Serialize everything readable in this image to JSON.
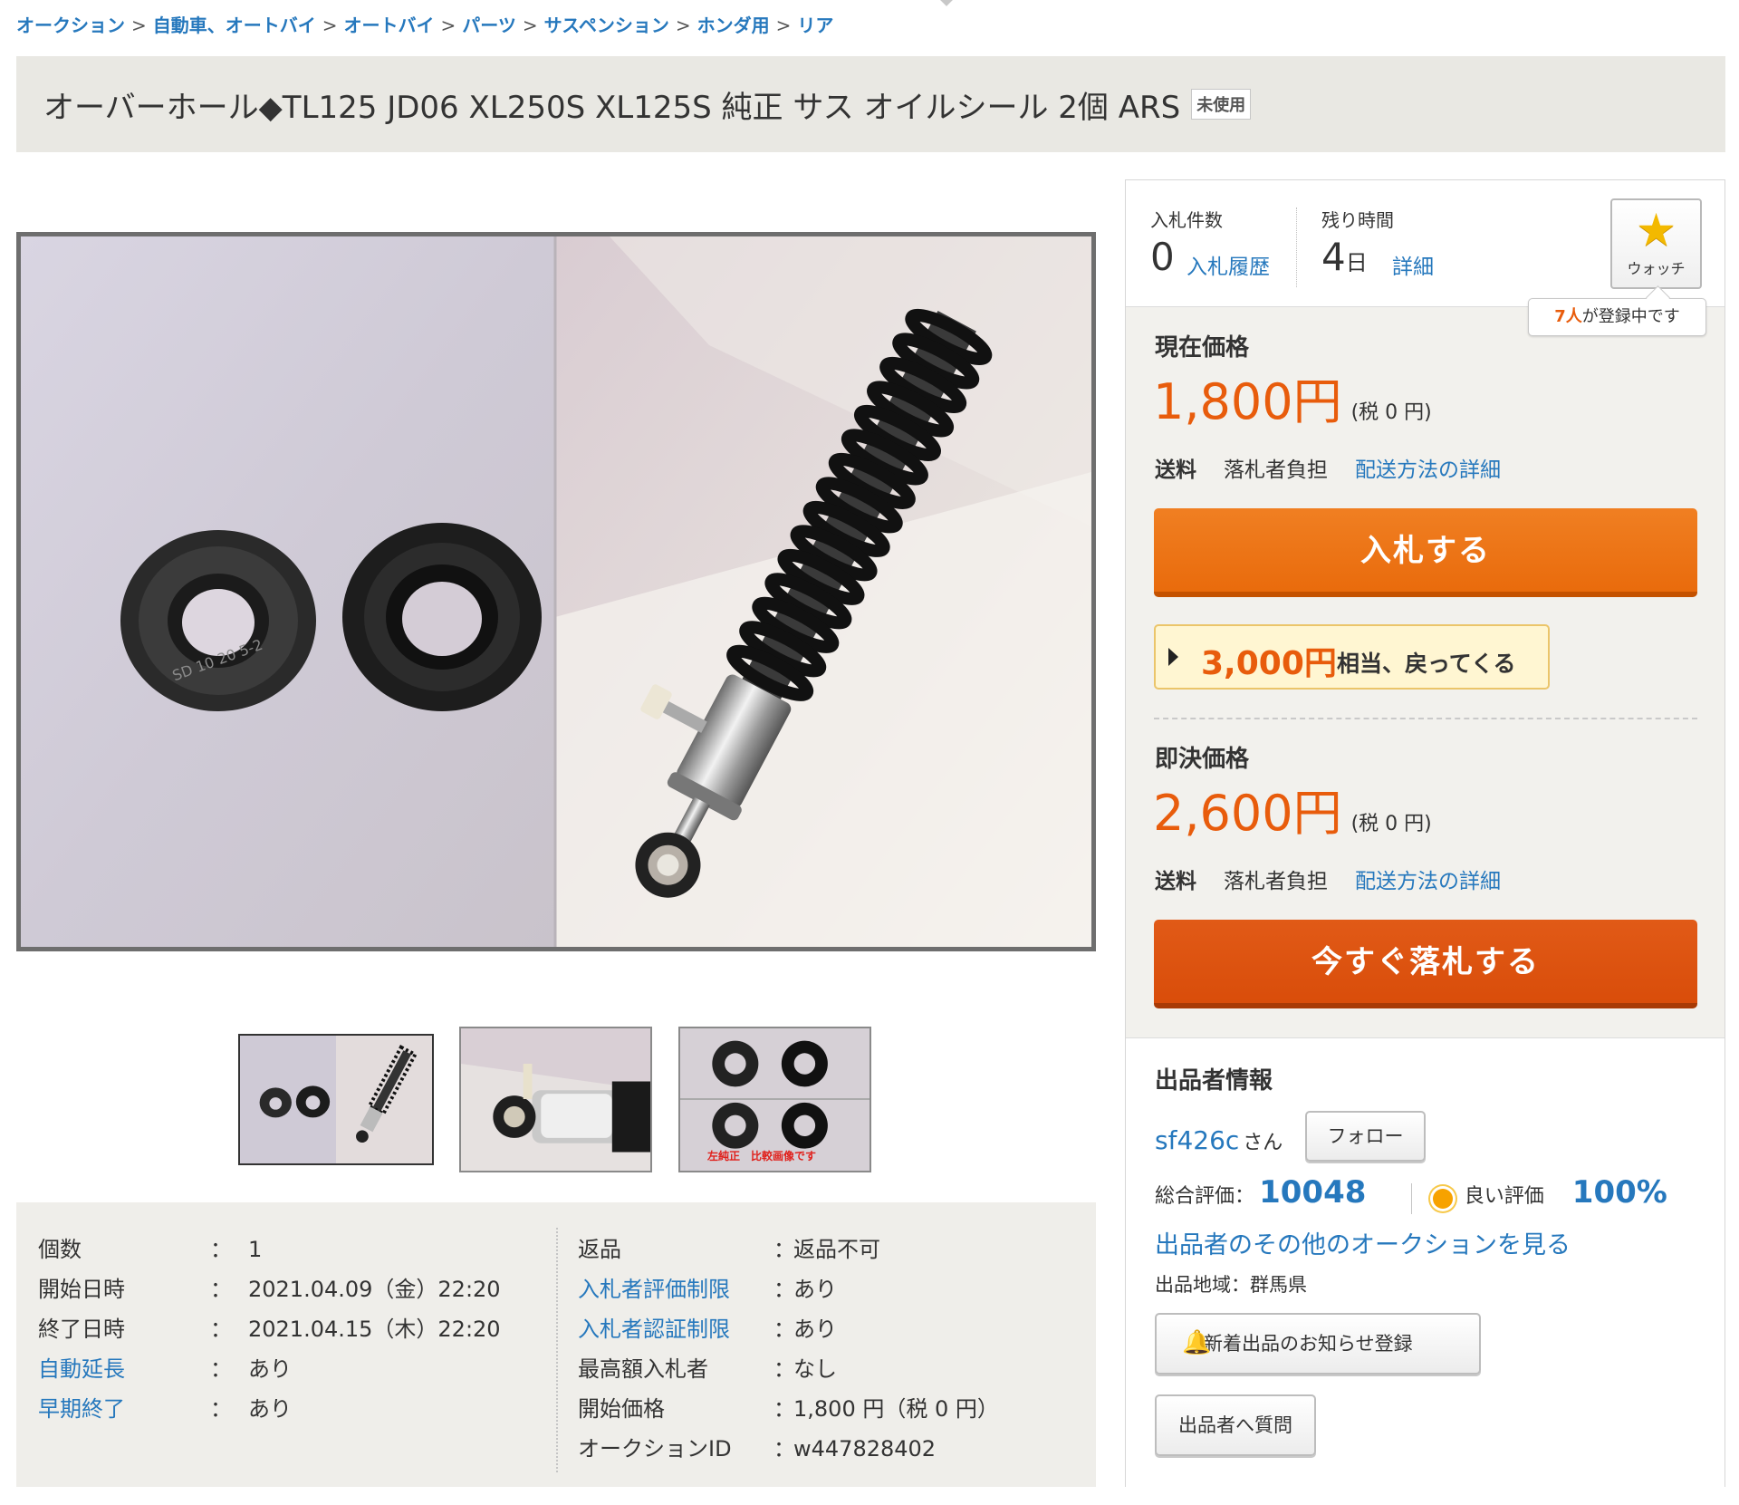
{
  "breadcrumb": [
    "オークション",
    "自動車、オートバイ",
    "オートバイ",
    "パーツ",
    "サスペンション",
    "ホンダ用",
    "リア"
  ],
  "breadcrumb_separator": ">",
  "title": "オーバーホール◆TL125 JD06 XL250S XL125S 純正 サス オイルシール 2個 ARS",
  "condition_badge": "未使用",
  "main_image": {
    "alt_icon": "product-photo",
    "seal_print": "SD 10 20 5-2"
  },
  "thumbnails": [
    {
      "name": "thumb-seals-and-shock",
      "caption": ""
    },
    {
      "name": "thumb-shock-closeup",
      "caption": ""
    },
    {
      "name": "thumb-seal-comparison",
      "caption": "左純正　比較画像です"
    }
  ],
  "details": {
    "left": [
      {
        "key": "個数",
        "colon": "：",
        "value": "1",
        "link": false
      },
      {
        "key": "開始日時",
        "colon": "：",
        "value": "2021.04.09（金）22:20",
        "link": false
      },
      {
        "key": "終了日時",
        "colon": "：",
        "value": "2021.04.15（木）22:20",
        "link": false
      },
      {
        "key": "自動延長",
        "colon": "：",
        "value": "あり",
        "link": true
      },
      {
        "key": "早期終了",
        "colon": "：",
        "value": "あり",
        "link": true
      }
    ],
    "right": [
      {
        "key": "返品",
        "colon": "：",
        "value": "返品不可",
        "link": false
      },
      {
        "key": "入札者評価制限",
        "colon": "：",
        "value": "あり",
        "link": true
      },
      {
        "key": "入札者認証制限",
        "colon": "：",
        "value": "あり",
        "link": true
      },
      {
        "key": "最高額入札者",
        "colon": "：",
        "value": "なし",
        "link": false
      },
      {
        "key": "開始価格",
        "colon": "：",
        "value": "1,800 円（税 0 円）",
        "link": false
      },
      {
        "key": "オークションID",
        "colon": "：",
        "value": "w447828402",
        "link": false
      }
    ]
  },
  "panel": {
    "bids_label": "入札件数",
    "bids_count": "0",
    "bids_history_link": "入札履歴",
    "time_label": "残り時間",
    "time_value": "4",
    "time_unit": "日",
    "time_detail_link": "詳細",
    "watch_label": "ウォッチ",
    "watch_count": "7人",
    "watch_tip_suffix": "が登録中です",
    "current_price_label": "現在価格",
    "current_price": "1,800円",
    "current_price_tax": "(税 0 円)",
    "shipping_label": "送料",
    "shipping_value": "落札者負担",
    "shipping_link": "配送方法の詳細",
    "bid_button": "入札する",
    "cashback_amount": "3,000円",
    "cashback_text": "相当、戻ってくる",
    "buynow_label": "即決価格",
    "buynow_price": "2,600円",
    "buynow_price_tax": "(税 0 円)",
    "buynow_shipping_label": "送料",
    "buynow_shipping_value": "落札者負担",
    "buynow_shipping_link": "配送方法の詳細",
    "buynow_button": "今すぐ落札する"
  },
  "seller": {
    "section_title": "出品者情報",
    "name": "sf426c",
    "honorific": "さん",
    "follow_button": "フォロー",
    "total_rating_label": "総合評価：",
    "total_rating": "10048",
    "good_rating_label": "良い評価",
    "good_rating": "100%",
    "other_auctions_link": "出品者のその他のオークションを見る",
    "region": "出品地域：群馬県",
    "notify_button": "新着出品のお知らせ登録",
    "question_button": "出品者へ質問"
  },
  "colors": {
    "link": "#2678bd",
    "price": "#e85c0c",
    "bid_button": "#ea6f10",
    "buynow_button": "#d94d0a",
    "title_bar_bg": "#e9e8e3",
    "panel_bg": "#f2f1ed"
  }
}
